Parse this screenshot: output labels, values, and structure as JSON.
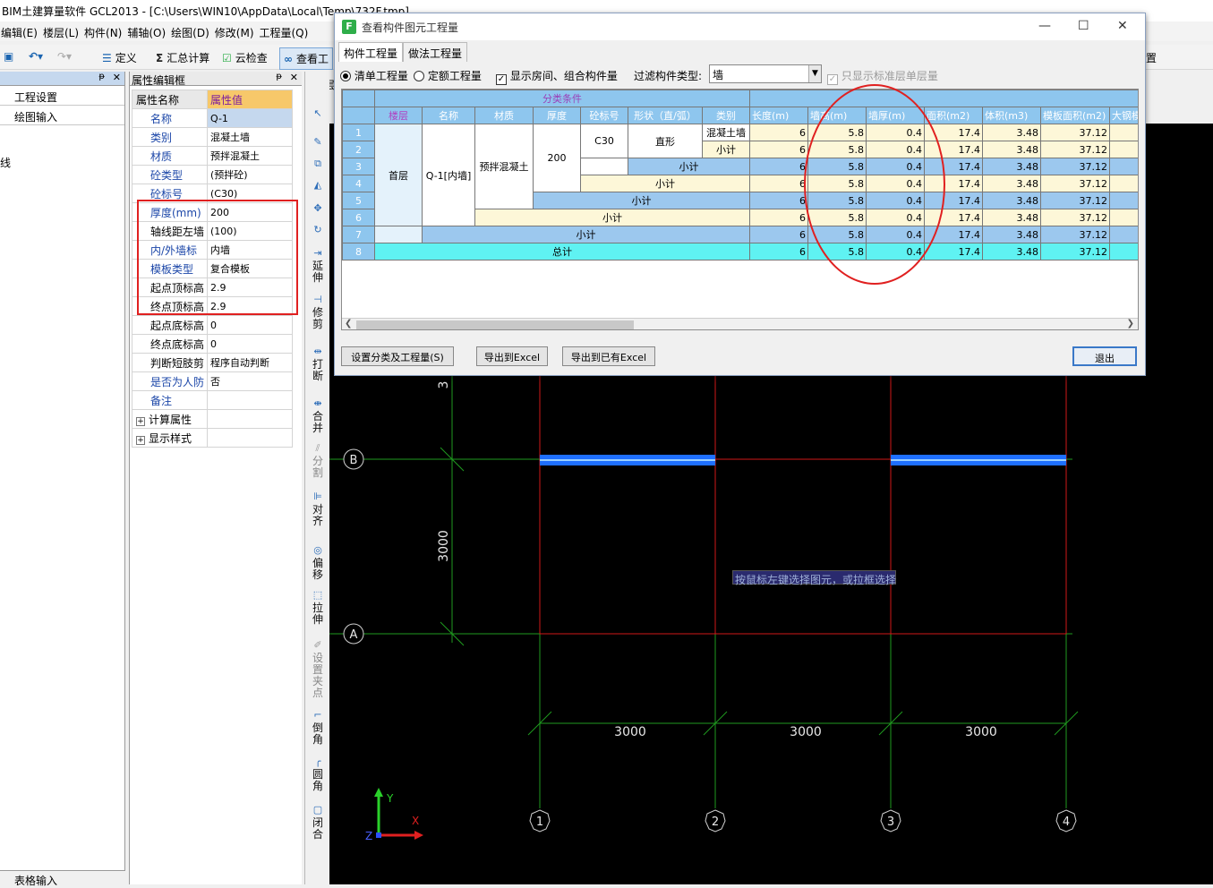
{
  "window": {
    "title": "BIM土建算量软件 GCL2013 - [C:\\Users\\WIN10\\AppData\\Local\\Temp\\732F.tmp]"
  },
  "menu": [
    "编辑(E)",
    "楼层(L)",
    "构件(N)",
    "辅轴(O)",
    "绘图(D)",
    "修改(M)",
    "工程量(Q)"
  ],
  "toolbar": {
    "define": "定义",
    "sum": "汇总计算",
    "cloud_check": "云检查",
    "view": "查看工",
    "settings": "置"
  },
  "left_panel": {
    "items": [
      "工程设置",
      "绘图输入"
    ],
    "edge_text": "线",
    "bottom_tab": "表格输入"
  },
  "prop_panel": {
    "title": "属性编辑框",
    "col_name": "属性名称",
    "col_value": "属性值",
    "rows": [
      {
        "name": "名称",
        "value": "Q-1"
      },
      {
        "name": "类别",
        "value": "混凝土墙"
      },
      {
        "name": "材质",
        "value": "预拌混凝土"
      },
      {
        "name": "砼类型",
        "value": "(预拌砼)"
      },
      {
        "name": "砼标号",
        "value": "(C30)"
      },
      {
        "name": "厚度(mm)",
        "value": "200"
      },
      {
        "name": "轴线距左墙",
        "value": "(100)"
      },
      {
        "name": "内/外墙标",
        "value": "内墙"
      },
      {
        "name": "模板类型",
        "value": "复合模板"
      },
      {
        "name": "起点顶标高",
        "value": "2.9"
      },
      {
        "name": "终点顶标高",
        "value": "2.9"
      },
      {
        "name": "起点底标高",
        "value": "0"
      },
      {
        "name": "终点底标高",
        "value": "0"
      },
      {
        "name": "判断短肢剪",
        "value": "程序自动判断"
      },
      {
        "name": "是否为人防",
        "value": "否"
      },
      {
        "name": "备注",
        "value": ""
      },
      {
        "name": "计算属性",
        "value": ""
      },
      {
        "name": "显示样式",
        "value": ""
      }
    ]
  },
  "floor_tab": "首层",
  "vertical_tools": [
    "延伸",
    "修剪",
    "打断",
    "合并",
    "分割",
    "对齐",
    "偏移",
    "拉伸",
    "设置夹点",
    "倒角",
    "圆角",
    "闭合"
  ],
  "dialog": {
    "title": "查看构件图元工程量",
    "tabs": [
      "构件工程量",
      "做法工程量"
    ],
    "radio_qd": "清单工程量",
    "radio_de": "定额工程量",
    "check_show": "显示房间、组合构件量",
    "filter_label": "过滤构件类型:",
    "filter_value": "墙",
    "check_std": "只显示标准层单层量",
    "group_header": "分类条件",
    "columns": [
      "楼层",
      "名称",
      "材质",
      "厚度",
      "砼标号",
      "形状（直/弧）",
      "类别",
      "长度(m)",
      "墙高(m)",
      "墙厚(m)",
      "面积(m2)",
      "体积(m3)",
      "模板面积(m2)",
      "大钢模"
    ],
    "row_numbers": [
      "1",
      "2",
      "3",
      "4",
      "5",
      "6",
      "7",
      "8"
    ],
    "floor": "首层",
    "name": "Q-1[内墙]",
    "material": "预拌混凝土",
    "thickness": "200",
    "grade": "C30",
    "shape": "直形",
    "category": "混凝土墙",
    "subtotal": "小计",
    "total": "总计",
    "values": {
      "length": "6",
      "height": "5.8",
      "wall_thk": "0.4",
      "area": "17.4",
      "volume": "3.48",
      "formwork": "37.12"
    },
    "buttons": {
      "set": "设置分类及工程量(S)",
      "export": "导出到Excel",
      "export_existing": "导出到已有Excel",
      "exit": "退出"
    }
  },
  "canvas": {
    "axis_rows": [
      "A",
      "B"
    ],
    "axis_cols": [
      "1",
      "2",
      "3",
      "4"
    ],
    "dim_horizontal": [
      "3000",
      "3000",
      "3000"
    ],
    "dim_vertical": "3000",
    "dim_partial": "3",
    "tooltip": "按鼠标左键选择图元，或拉框选择",
    "ucs": [
      "Y",
      "X",
      "Z"
    ]
  }
}
